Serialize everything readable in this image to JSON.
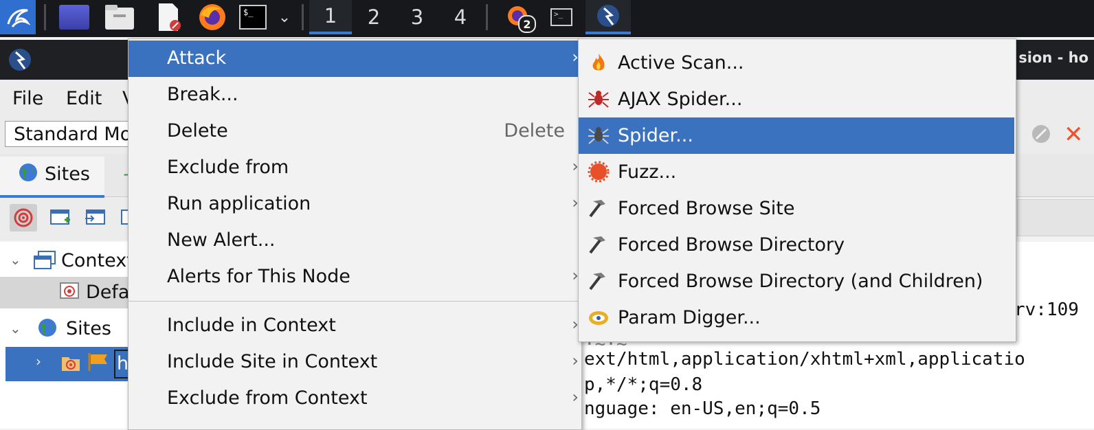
{
  "taskbar": {
    "workspaces": [
      "1",
      "2",
      "3",
      "4"
    ],
    "firefox_badge": "2"
  },
  "window": {
    "title_fragment": "sion - ho"
  },
  "menubar": {
    "items": [
      "File",
      "Edit",
      "V"
    ]
  },
  "toolbar": {
    "mode_value": "Standard Mo"
  },
  "tabs": {
    "sites_label": "Sites"
  },
  "tree": {
    "contexts_label": "Context",
    "default_context_label": "Defa",
    "sites_label": "Sites",
    "selected_node_label": "h"
  },
  "request_text": {
    "lines": [
      "rv:109",
      "ext/html,application/xhtml+xml,applicatio",
      "p,*/*;q=0.8",
      "nguage: en-US,en;q=0.5"
    ]
  },
  "context_menu": {
    "items": [
      {
        "label": "Attack",
        "submenu": true
      },
      {
        "label": "Break..."
      },
      {
        "label": "Delete",
        "shortcut": "Delete"
      },
      {
        "label": "Exclude from",
        "submenu": true
      },
      {
        "label": "Run application",
        "submenu": true
      },
      {
        "label": "New Alert..."
      },
      {
        "label": "Alerts for This Node",
        "submenu": true
      },
      {
        "label": "Include in Context",
        "submenu": true
      },
      {
        "label": "Include Site in Context",
        "submenu": true
      },
      {
        "label": "Exclude from Context",
        "submenu": true
      }
    ]
  },
  "attack_submenu": {
    "items": [
      {
        "label": "Active Scan...",
        "icon": "flame-icon"
      },
      {
        "label": "AJAX Spider...",
        "icon": "red-spider-icon"
      },
      {
        "label": "Spider...",
        "icon": "spider-icon"
      },
      {
        "label": "Fuzz...",
        "icon": "fuzz-icon"
      },
      {
        "label": "Forced Browse Site",
        "icon": "hammer-icon"
      },
      {
        "label": "Forced Browse Directory",
        "icon": "hammer-icon"
      },
      {
        "label": "Forced Browse Directory (and Children)",
        "icon": "hammer-icon"
      },
      {
        "label": "Param Digger...",
        "icon": "param-digger-icon"
      }
    ]
  },
  "colors": {
    "highlight": "#3a72bf",
    "taskbar": "#16181b",
    "accent": "#3a7bd5"
  }
}
